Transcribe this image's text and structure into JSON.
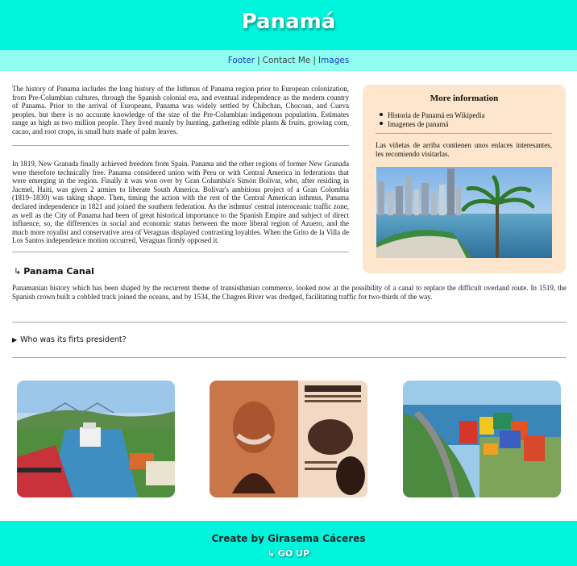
{
  "header": {
    "title": "Panamá"
  },
  "nav": {
    "footer": "Footer",
    "contact": "Contact Me",
    "images": "Images",
    "separator": "|"
  },
  "main": {
    "paragraph_1": "The history of Panama includes the long history of the Isthmus of Panama region prior to European colonization, from Pre-Columbian cultures, through the Spanish colonial era, and eventual independence as the modern country of Panama. Prior to the arrival of Europeans, Panama was widely settled by Chibchan, Chocoan, and Cueva peoples, but there is no accurate knowledge of the size of the Pre-Columbian indigenous population. Estimates range as high as two million people. They lived mainly by hunting, gathering edible plants & fruits, growing corn, cacao, and root crops, in small huts made of palm leaves.",
    "paragraph_2": "In 1819, New Granada finally achieved freedom from Spain. Panama and the other regions of former New Granada were therefore technically free. Panama considered union with Peru or with Central America in federations that were emerging in the region. Finally it was won over by Gran Columbia's Simón Bolívar, who, after residing in Jacmel, Haiti, was given 2 armies to liberate South America. Bolívar's ambitious project of a Gran Colombia (1819–1830) was taking shape. Then, timing the action with the rest of the Central American isthmus, Panama declared independence in 1821 and joined the southern federation. As the isthmus' central interoceanic traffic zone, as well as the City of Panama had been of great historical importance to the Spanish Empire and subject of direct influence, so, the differences in social and economic status between the more liberal region of Azuero, and the much more royalist and conservative area of Veraguas displayed contrasting loyalties. When the Grito de la Villa de Los Santos independence motion occurred, Veraguas firmly opposed it.",
    "canal_arrow": "↳",
    "canal_title": "Panama Canal",
    "canal_paragraph": "Panamanian history which has been shaped by the recurrent theme of transisthmian commerce, looked now at the possibility of a canal to replace the difficult overland route. In 1519, the Spanish crown built a cobbled track joined the oceans, and by 1534, the Chagres River was dredged, facilitating traffic for two-thirds of the way.",
    "details_marker": "▶",
    "details_summary": "Who was its firts president?"
  },
  "aside": {
    "title": "More information",
    "links": [
      "Historia de Panamá en Wikipedia",
      "Imagenes de panamá"
    ],
    "note": "Las viñetas de arriba contienen unos enlaces interesantes, les recomiendo visitarlas."
  },
  "footer": {
    "credit": "Create by Girasema Cáceres",
    "goup": "↳ GO UP"
  },
  "colors": {
    "teal": "#00f5dc",
    "light_teal": "#8ffdf0",
    "aside_bg": "#fde6cd",
    "link": "#1540c8"
  }
}
